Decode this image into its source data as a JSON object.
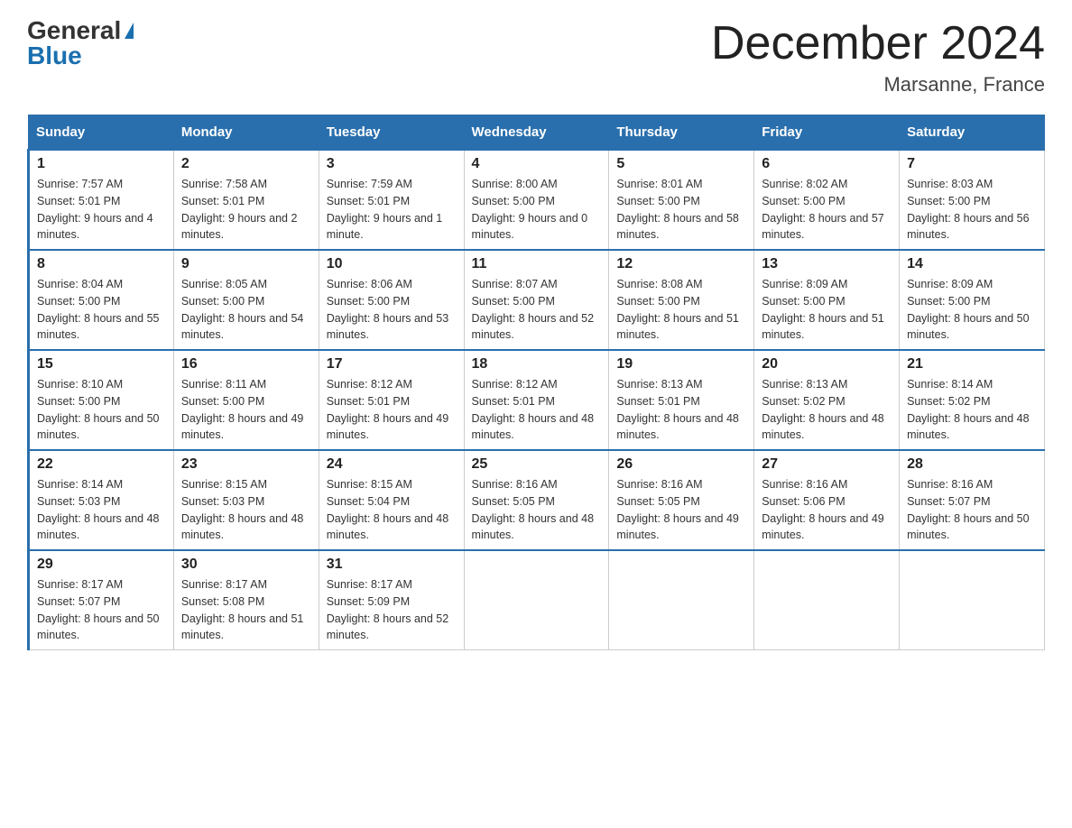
{
  "header": {
    "logo_general": "General",
    "logo_blue": "Blue",
    "main_title": "December 2024",
    "subtitle": "Marsanne, France"
  },
  "days_of_week": [
    "Sunday",
    "Monday",
    "Tuesday",
    "Wednesday",
    "Thursday",
    "Friday",
    "Saturday"
  ],
  "weeks": [
    [
      {
        "num": "1",
        "sunrise": "7:57 AM",
        "sunset": "5:01 PM",
        "daylight": "9 hours and 4 minutes."
      },
      {
        "num": "2",
        "sunrise": "7:58 AM",
        "sunset": "5:01 PM",
        "daylight": "9 hours and 2 minutes."
      },
      {
        "num": "3",
        "sunrise": "7:59 AM",
        "sunset": "5:01 PM",
        "daylight": "9 hours and 1 minute."
      },
      {
        "num": "4",
        "sunrise": "8:00 AM",
        "sunset": "5:00 PM",
        "daylight": "9 hours and 0 minutes."
      },
      {
        "num": "5",
        "sunrise": "8:01 AM",
        "sunset": "5:00 PM",
        "daylight": "8 hours and 58 minutes."
      },
      {
        "num": "6",
        "sunrise": "8:02 AM",
        "sunset": "5:00 PM",
        "daylight": "8 hours and 57 minutes."
      },
      {
        "num": "7",
        "sunrise": "8:03 AM",
        "sunset": "5:00 PM",
        "daylight": "8 hours and 56 minutes."
      }
    ],
    [
      {
        "num": "8",
        "sunrise": "8:04 AM",
        "sunset": "5:00 PM",
        "daylight": "8 hours and 55 minutes."
      },
      {
        "num": "9",
        "sunrise": "8:05 AM",
        "sunset": "5:00 PM",
        "daylight": "8 hours and 54 minutes."
      },
      {
        "num": "10",
        "sunrise": "8:06 AM",
        "sunset": "5:00 PM",
        "daylight": "8 hours and 53 minutes."
      },
      {
        "num": "11",
        "sunrise": "8:07 AM",
        "sunset": "5:00 PM",
        "daylight": "8 hours and 52 minutes."
      },
      {
        "num": "12",
        "sunrise": "8:08 AM",
        "sunset": "5:00 PM",
        "daylight": "8 hours and 51 minutes."
      },
      {
        "num": "13",
        "sunrise": "8:09 AM",
        "sunset": "5:00 PM",
        "daylight": "8 hours and 51 minutes."
      },
      {
        "num": "14",
        "sunrise": "8:09 AM",
        "sunset": "5:00 PM",
        "daylight": "8 hours and 50 minutes."
      }
    ],
    [
      {
        "num": "15",
        "sunrise": "8:10 AM",
        "sunset": "5:00 PM",
        "daylight": "8 hours and 50 minutes."
      },
      {
        "num": "16",
        "sunrise": "8:11 AM",
        "sunset": "5:00 PM",
        "daylight": "8 hours and 49 minutes."
      },
      {
        "num": "17",
        "sunrise": "8:12 AM",
        "sunset": "5:01 PM",
        "daylight": "8 hours and 49 minutes."
      },
      {
        "num": "18",
        "sunrise": "8:12 AM",
        "sunset": "5:01 PM",
        "daylight": "8 hours and 48 minutes."
      },
      {
        "num": "19",
        "sunrise": "8:13 AM",
        "sunset": "5:01 PM",
        "daylight": "8 hours and 48 minutes."
      },
      {
        "num": "20",
        "sunrise": "8:13 AM",
        "sunset": "5:02 PM",
        "daylight": "8 hours and 48 minutes."
      },
      {
        "num": "21",
        "sunrise": "8:14 AM",
        "sunset": "5:02 PM",
        "daylight": "8 hours and 48 minutes."
      }
    ],
    [
      {
        "num": "22",
        "sunrise": "8:14 AM",
        "sunset": "5:03 PM",
        "daylight": "8 hours and 48 minutes."
      },
      {
        "num": "23",
        "sunrise": "8:15 AM",
        "sunset": "5:03 PM",
        "daylight": "8 hours and 48 minutes."
      },
      {
        "num": "24",
        "sunrise": "8:15 AM",
        "sunset": "5:04 PM",
        "daylight": "8 hours and 48 minutes."
      },
      {
        "num": "25",
        "sunrise": "8:16 AM",
        "sunset": "5:05 PM",
        "daylight": "8 hours and 48 minutes."
      },
      {
        "num": "26",
        "sunrise": "8:16 AM",
        "sunset": "5:05 PM",
        "daylight": "8 hours and 49 minutes."
      },
      {
        "num": "27",
        "sunrise": "8:16 AM",
        "sunset": "5:06 PM",
        "daylight": "8 hours and 49 minutes."
      },
      {
        "num": "28",
        "sunrise": "8:16 AM",
        "sunset": "5:07 PM",
        "daylight": "8 hours and 50 minutes."
      }
    ],
    [
      {
        "num": "29",
        "sunrise": "8:17 AM",
        "sunset": "5:07 PM",
        "daylight": "8 hours and 50 minutes."
      },
      {
        "num": "30",
        "sunrise": "8:17 AM",
        "sunset": "5:08 PM",
        "daylight": "8 hours and 51 minutes."
      },
      {
        "num": "31",
        "sunrise": "8:17 AM",
        "sunset": "5:09 PM",
        "daylight": "8 hours and 52 minutes."
      },
      null,
      null,
      null,
      null
    ]
  ],
  "labels": {
    "sunrise": "Sunrise:",
    "sunset": "Sunset:",
    "daylight": "Daylight:"
  }
}
